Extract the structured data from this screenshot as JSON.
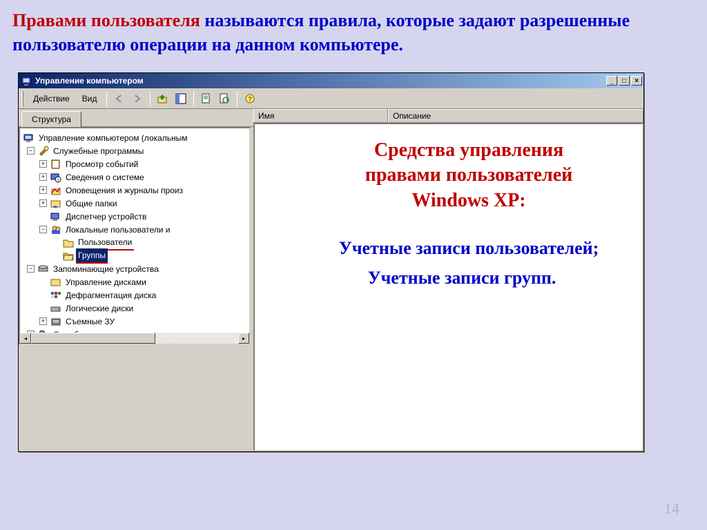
{
  "slide": {
    "red_part": "Правами пользователя",
    "blue_part_1": " называются правила, которые задают разрешенные пользователю операции на данном компьютере."
  },
  "window": {
    "title": "Управление компьютером",
    "menu": {
      "action": "Действие",
      "view": "Вид"
    },
    "tab": "Структура",
    "columns": {
      "name": "Имя",
      "desc": "Описание"
    },
    "tree": {
      "root": "Управление компьютером (локальным",
      "utilities": "Служебные программы",
      "event_viewer": "Просмотр событий",
      "sysinfo": "Сведения о системе",
      "alerts": "Оповещения и журналы произ",
      "shared": "Общие папки",
      "devmgr": "Диспетчер устройств",
      "local_users": "Локальные пользователи и",
      "users": "Пользователи",
      "groups": "Группы",
      "storage": "Запоминающие устройства",
      "diskmgmt": "Управление дисками",
      "defrag": "Дефрагментация диска",
      "logical": "Логические диски",
      "removable": "Съемные ЗУ",
      "services": "Службы и приложения"
    }
  },
  "overlay": {
    "title_l1": "Средства управления",
    "title_l2": "правами пользователей",
    "title_l3": "Windows XP:",
    "line1": "Учетные записи пользователей;",
    "line2": "Учетные записи групп."
  },
  "page_number": "14"
}
